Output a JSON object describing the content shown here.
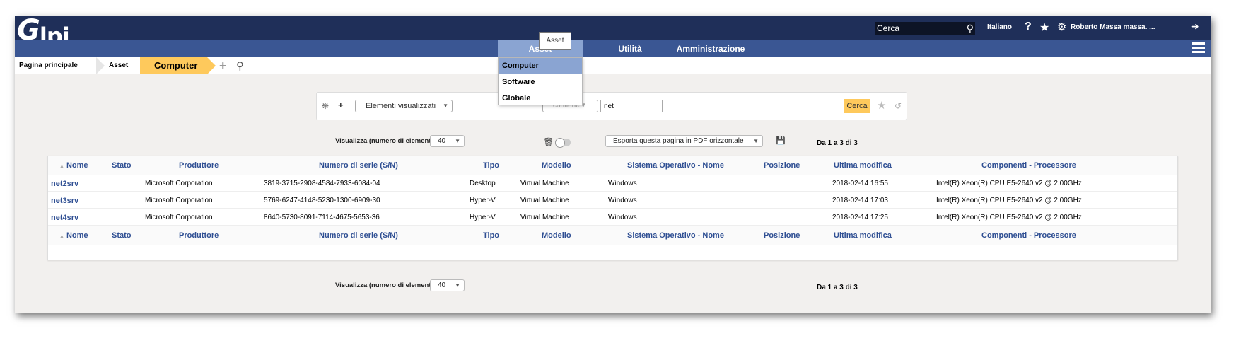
{
  "header": {
    "logo": "Glpi",
    "search_placeholder": "Cerca",
    "language": "Italiano",
    "user": "Roberto Massa massa. ..."
  },
  "menu": {
    "tooltip": "Asset",
    "items": [
      "Asset",
      "Utilità",
      "Amministrazione"
    ],
    "dropdown": [
      "Computer",
      "Software",
      "Globale"
    ]
  },
  "breadcrumb": [
    "Pagina principale",
    "Asset",
    "Computer"
  ],
  "search": {
    "field": "Elementi visualizzati",
    "operator": "contiene",
    "value": "net",
    "button": "Cerca"
  },
  "pager": {
    "label": "Visualizza (numero di elementi)",
    "per_page": "40",
    "export": "Esporta questa pagina in PDF orizzontale",
    "count": "Da 1 a 3 di 3"
  },
  "table": {
    "columns": [
      "Nome",
      "Stato",
      "Produttore",
      "Numero di serie (S/N)",
      "Tipo",
      "Modello",
      "Sistema Operativo - Nome",
      "Posizione",
      "Ultima modifica",
      "Componenti - Processore"
    ],
    "rows": [
      [
        "net2srv",
        "",
        "Microsoft Corporation",
        "3819-3715-2908-4584-7933-6084-04",
        "Desktop",
        "Virtual Machine",
        "Windows",
        "",
        "2018-02-14 16:55",
        "Intel(R) Xeon(R) CPU E5-2640 v2 @ 2.00GHz"
      ],
      [
        "net3srv",
        "",
        "Microsoft Corporation",
        "5769-6247-4148-5230-1300-6909-30",
        "Hyper-V",
        "Virtual Machine",
        "Windows",
        "",
        "2018-02-14 17:03",
        "Intel(R) Xeon(R) CPU E5-2640 v2 @ 2.00GHz"
      ],
      [
        "net4srv",
        "",
        "Microsoft Corporation",
        "8640-5730-8091-7114-4675-5653-36",
        "Hyper-V",
        "Virtual Machine",
        "Windows",
        "",
        "2018-02-14 17:25",
        "Intel(R) Xeon(R) CPU E5-2640 v2 @ 2.00GHz"
      ]
    ]
  },
  "colors": {
    "topbar": "#1f2f59",
    "menubar": "#3a5693",
    "active_menu": "#8aa4d2",
    "accent": "#fec95c",
    "link": "#2f4f93"
  }
}
